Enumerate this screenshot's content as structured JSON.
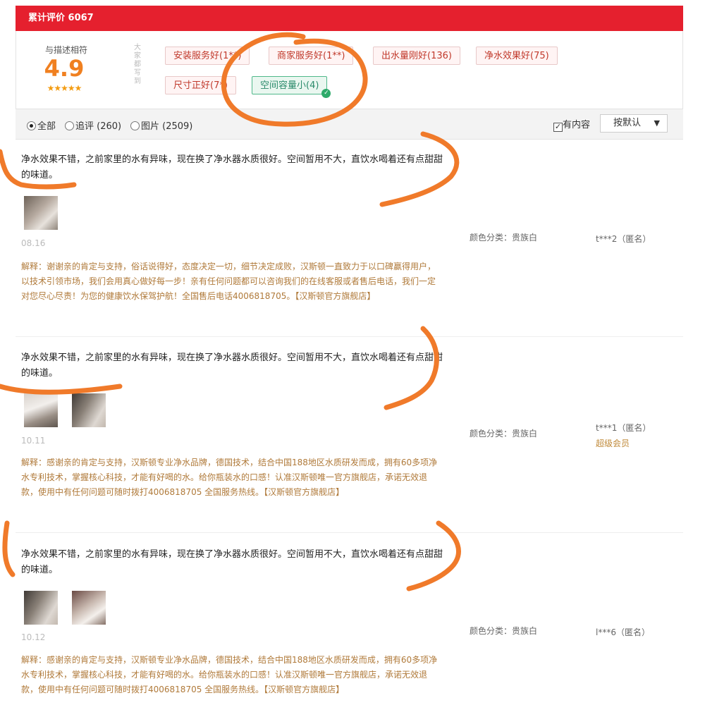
{
  "header": {
    "title": "累计评价 6067"
  },
  "summary": {
    "score_label": "与描述相符",
    "score": "4.9",
    "stars": "★★★★★",
    "side_label": "大家都写到",
    "tags": [
      {
        "label": "安装服务好(1**)",
        "selected": false
      },
      {
        "label": "商家服务好(1**)",
        "selected": false
      },
      {
        "label": "出水量刚好(136)",
        "selected": false
      },
      {
        "label": "净水效果好(75)",
        "selected": false
      },
      {
        "label": "尺寸正好(7*)",
        "selected": false
      },
      {
        "label": "空间容量小(4)",
        "selected": true
      }
    ]
  },
  "filters": {
    "all": "全部",
    "followup": "追评 (260)",
    "pictures": "图片 (2509)",
    "has_content": "有内容",
    "sort": "按默认"
  },
  "reviews": [
    {
      "text": "净水效果不错，之前家里的水有异味，现在换了净水器水质很好。空间暂用不大，直饮水喝着还有点甜甜的味道。",
      "date": "08.16",
      "reply": "解释：谢谢亲的肯定与支持，俗话说得好，态度决定一切，细节决定成败，汉斯顿一直致力于以口碑赢得用户，以技术引领市场，我们会用真心做好每一步！亲有任何问题都可以咨询我们的在线客服或者售后电话，我们一定对您尽心尽责！为您的健康饮水保驾护航！全国售后电话4006818705。【汉斯顿官方旗舰店】",
      "color": "颜色分类：贵族白",
      "user": "t***2（匿名）",
      "vip": ""
    },
    {
      "text": "净水效果不错，之前家里的水有异味，现在换了净水器水质很好。空间暂用不大，直饮水喝着还有点甜甜的味道。",
      "date": "10.11",
      "reply": "解释：感谢亲的肯定与支持，汉斯顿专业净水品牌，德国技术，结合中国188地区水质研发而成，拥有60多项净水专利技术，掌握核心科技，才能有好喝的水。给你瓶装水的口感！认准汉斯顿唯一官方旗舰店，承诺无效退款，使用中有任何问题可随时拨打4006818705 全国服务热线。【汉斯顿官方旗舰店】",
      "color": "颜色分类：贵族白",
      "user": "t***1（匿名）",
      "vip": "超级会员"
    },
    {
      "text": "净水效果不错，之前家里的水有异味，现在换了净水器水质很好。空间暂用不大，直饮水喝着还有点甜甜的味道。",
      "date": "10.12",
      "reply": "解释：感谢亲的肯定与支持，汉斯顿专业净水品牌，德国技术，结合中国188地区水质研发而成，拥有60多项净水专利技术，掌握核心科技，才能有好喝的水。给你瓶装水的口感！认准汉斯顿唯一官方旗舰店，承诺无效退款，使用中有任何问题可随时拨打4006818705 全国服务热线。【汉斯顿官方旗舰店】",
      "color": "颜色分类：贵族白",
      "user": "l***6（匿名）",
      "vip": ""
    }
  ],
  "colors": {
    "brand_red": "#e5202e",
    "score_orange": "#f08020",
    "reply_brown": "#b07a3a",
    "annotation_orange": "#f07a2a"
  }
}
